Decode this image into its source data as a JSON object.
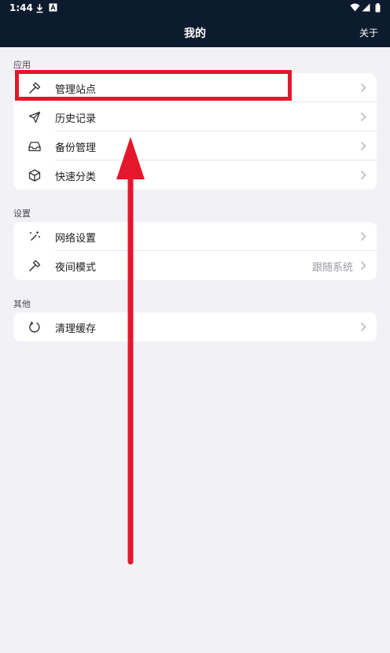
{
  "status_bar": {
    "time": "1:44",
    "icons": [
      "download-icon",
      "notification-a-icon",
      "wifi-icon",
      "signal-icon",
      "battery-icon"
    ]
  },
  "app_bar": {
    "title": "我的",
    "about_label": "关于"
  },
  "sections": [
    {
      "title": "应用",
      "items": [
        {
          "label": "管理站点",
          "icon": "hammer-icon"
        },
        {
          "label": "历史记录",
          "icon": "send-icon"
        },
        {
          "label": "备份管理",
          "icon": "inbox-icon"
        },
        {
          "label": "快速分类",
          "icon": "cube-icon"
        }
      ]
    },
    {
      "title": "设置",
      "items": [
        {
          "label": "网络设置",
          "icon": "magic-wand-icon"
        },
        {
          "label": "夜间模式",
          "icon": "hammer-icon",
          "value": "跟随系统"
        }
      ]
    },
    {
      "title": "其他",
      "items": [
        {
          "label": "清理缓存",
          "icon": "refresh-icon"
        }
      ]
    }
  ],
  "annotation": {
    "highlight_color": "#e5172c",
    "highlighted_item": "管理站点",
    "arrow_direction": "up"
  },
  "colors": {
    "header_bg": "#0d1b2e",
    "page_bg": "#f1f1f6",
    "card_bg": "#ffffff",
    "chevron": "#b0b0b8"
  }
}
